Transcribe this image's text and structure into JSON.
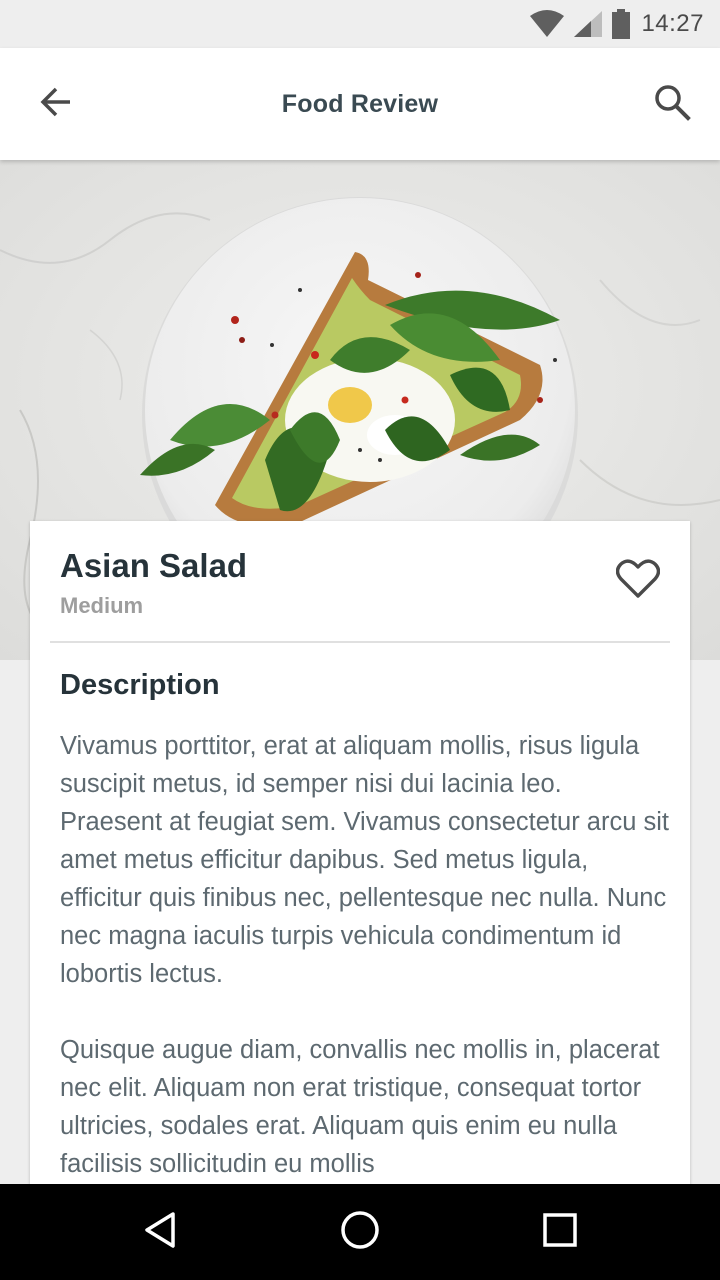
{
  "status_bar": {
    "time": "14:27",
    "icons": [
      "wifi-icon",
      "cellular-signal-icon",
      "battery-icon"
    ]
  },
  "app_bar": {
    "title": "Food Review",
    "back_icon": "arrow-back-icon",
    "search_icon": "search-icon"
  },
  "hero": {
    "image": "avocado-toast-with-spinach-and-poached-egg"
  },
  "card": {
    "title": "Asian Salad",
    "subtitle": "Medium",
    "favorite_icon": "heart-outline-icon",
    "section_heading": "Description",
    "paragraphs": [
      "Vivamus porttitor, erat at aliquam mollis, risus ligula suscipit metus, id semper nisi dui lacinia leo. Praesent at feugiat sem. Vivamus consectetur arcu sit amet metus efficitur dapibus. Sed metus ligula, efficitur quis finibus nec, pellentesque nec nulla. Nunc nec magna iaculis turpis vehicula condimentum id lobortis lectus.",
      "Quisque augue diam, convallis nec mollis in, placerat nec elit. Aliquam non erat tristique, consequat tortor ultricies, sodales erat. Aliquam quis enim eu nulla facilisis sollicitudin eu mollis"
    ]
  },
  "nav_bar": {
    "icons": [
      "nav-back-icon",
      "nav-home-icon",
      "nav-recents-icon"
    ]
  },
  "colors": {
    "app_bar_bg": "#ffffff",
    "title_text": "#3a4a52",
    "body_text": "#5d6970",
    "subtitle_text": "#9e9e9e",
    "screen_bg": "#eeeeee",
    "nav_bar_bg": "#000000"
  }
}
